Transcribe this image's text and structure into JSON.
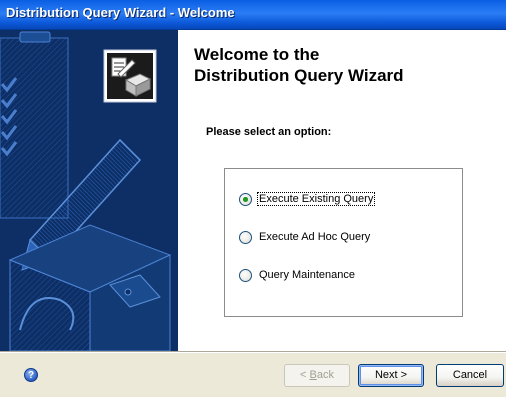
{
  "window": {
    "title": "Distribution Query Wizard - Welcome"
  },
  "welcome": {
    "heading_line1": "Welcome to the",
    "heading_line2": "Distribution Query Wizard",
    "prompt": "Please select an option:"
  },
  "options": [
    {
      "label": "Execute Existing Query",
      "selected": true
    },
    {
      "label": "Execute Ad Hoc Query",
      "selected": false
    },
    {
      "label": "Query Maintenance",
      "selected": false
    }
  ],
  "footer": {
    "help_icon": "help-icon",
    "help_glyph": "?",
    "back_prefix": "< ",
    "back_key": "B",
    "back_rest": "ack",
    "next_label": "Next >",
    "cancel_label": "Cancel"
  },
  "colors": {
    "titlebar": "#0a5ee3",
    "sidebar": "#0e2f66",
    "radio_selected": "#21a121"
  }
}
